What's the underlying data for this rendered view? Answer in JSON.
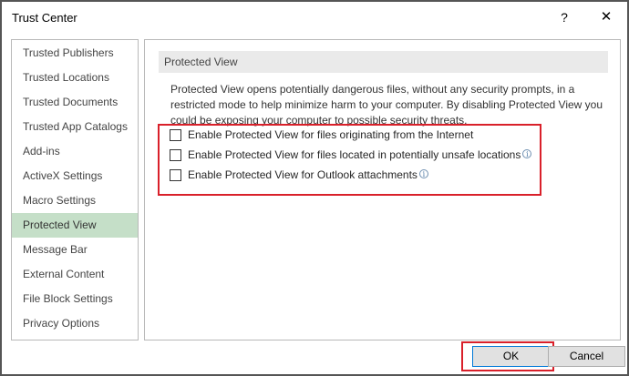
{
  "window": {
    "title": "Trust Center",
    "help_glyph": "?",
    "close_glyph": "✕"
  },
  "nav": {
    "items": [
      {
        "label": "Trusted Publishers"
      },
      {
        "label": "Trusted Locations"
      },
      {
        "label": "Trusted Documents"
      },
      {
        "label": "Trusted App Catalogs"
      },
      {
        "label": "Add-ins"
      },
      {
        "label": "ActiveX Settings"
      },
      {
        "label": "Macro Settings"
      },
      {
        "label": "Protected View",
        "selected": true
      },
      {
        "label": "Message Bar"
      },
      {
        "label": "External Content"
      },
      {
        "label": "File Block Settings"
      },
      {
        "label": "Privacy Options"
      }
    ]
  },
  "section": {
    "header": "Protected View",
    "description": "Protected View opens potentially dangerous files, without any security prompts, in a restricted mode to help minimize harm to your computer. By disabling Protected View you could be exposing your computer to possible security threats.",
    "options": [
      {
        "label": "Enable Protected View for files originating from the Internet",
        "checked": false,
        "info": false
      },
      {
        "label": "Enable Protected View for files located in potentially unsafe locations",
        "checked": false,
        "info": true
      },
      {
        "label": "Enable Protected View for Outlook attachments",
        "checked": false,
        "info": true
      }
    ],
    "info_glyph": "i"
  },
  "buttons": {
    "ok": "OK",
    "cancel": "Cancel"
  },
  "colors": {
    "highlight": "#d9202a",
    "selected_nav": "#c5dfc8"
  }
}
